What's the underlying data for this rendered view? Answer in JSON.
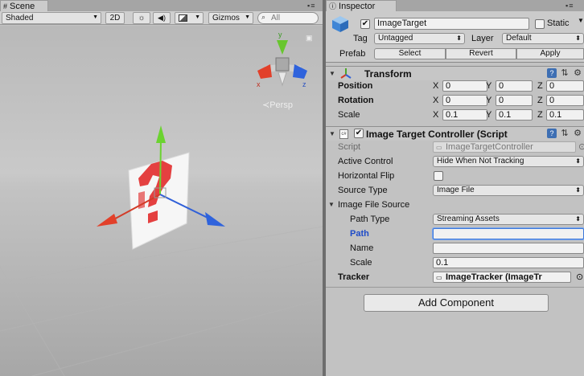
{
  "scene": {
    "tab_label": "Scene",
    "toolbar": {
      "shading_mode": "Shaded",
      "mode_2d": "2D",
      "sun_icon": "lighting-icon",
      "audio_icon": "speaker-icon",
      "image_icon": "effects-image-icon",
      "gizmos": "Gizmos",
      "search_placeholder": "All"
    },
    "persp_label": "Persp",
    "gizmo_axis_labels": {
      "y": "y",
      "x": "x",
      "z": "z"
    }
  },
  "inspector": {
    "tab_label": "Inspector",
    "object": {
      "active": true,
      "name": "ImageTarget",
      "static_label": "Static",
      "static_checked": false,
      "tag_label": "Tag",
      "tag_value": "Untagged",
      "layer_label": "Layer",
      "layer_value": "Default",
      "prefab_label": "Prefab",
      "prefab_select": "Select",
      "prefab_revert": "Revert",
      "prefab_apply": "Apply"
    },
    "transform": {
      "title": "Transform",
      "position_label": "Position",
      "rotation_label": "Rotation",
      "scale_label": "Scale",
      "axes": [
        "X",
        "Y",
        "Z"
      ],
      "position": [
        "0",
        "0",
        "0"
      ],
      "rotation": [
        "0",
        "0",
        "0"
      ],
      "scale": [
        "0.1",
        "0.1",
        "0.1"
      ]
    },
    "controller": {
      "title": "Image Target Controller (Script",
      "enabled": true,
      "script_label": "Script",
      "script_value": "ImageTargetController",
      "active_control_label": "Active Control",
      "active_control_value": "Hide When Not Tracking",
      "horizontal_flip_label": "Horizontal Flip",
      "horizontal_flip_checked": false,
      "source_type_label": "Source Type",
      "source_type_value": "Image File",
      "image_file_source_label": "Image File Source",
      "path_type_label": "Path Type",
      "path_type_value": "Streaming Assets",
      "path_label": "Path",
      "path_value": "",
      "name_label": "Name",
      "name_value": "",
      "scale_label": "Scale",
      "scale_value": "0.1",
      "tracker_label": "Tracker",
      "tracker_value": "ImageTracker (ImageTr"
    },
    "add_component": "Add Component"
  }
}
